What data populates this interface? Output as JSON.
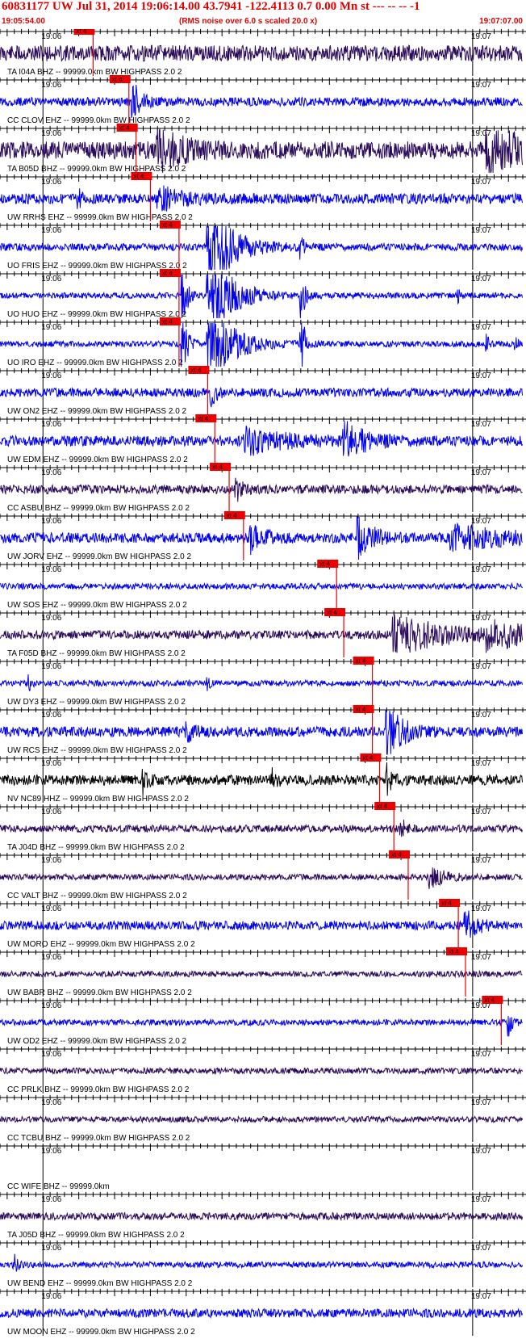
{
  "header": {
    "title": "60831177 UW Jul 31, 2014 19:06:14.00   43.7941 -122.4113  0.7 0.00 Mn st --- -- --  -1",
    "start_time": "19:05:54.00",
    "noise_note": "(RMS noise over 6.0 s scaled 20.0 x)",
    "end_time": "19:07:07.00"
  },
  "chart_data": {
    "type": "line",
    "title": "60831177 UW Jul 31, 2014 19:06:14.00   43.7941 -122.4113  0.7 0.00 Mn st --- -- --  -1",
    "x_start": "19:05:54.00",
    "x_end": "19:07:07.00",
    "tick_labels": [
      "19:06",
      "19:07"
    ],
    "pick_label": "xt 4",
    "colors": {
      "blue": "#0000ee",
      "dark": "#2a0a5a",
      "black": "#000000",
      "pick": "#ee0000",
      "title": "#e00000"
    },
    "traces": [
      {
        "label": "TA I04A BHZ -- 99999.0km BW  HIGHPASS  2.0  2",
        "color": "dark",
        "pick_s": 13.0,
        "amp": 0.55,
        "seed": 11,
        "events": []
      },
      {
        "label": "CC CLOV EHZ -- 99999.0km BW  HIGHPASS  2.0  2",
        "color": "blue",
        "pick_s": 18.0,
        "amp": 0.3,
        "seed": 12,
        "events": [
          {
            "t": 18.5,
            "a": 1.6,
            "w": 1.0
          }
        ]
      },
      {
        "label": "TA B05D BHZ -- 99999.0km BW  HIGHPASS  2.0  2",
        "color": "dark",
        "pick_s": 19.0,
        "amp": 0.6,
        "seed": 13,
        "events": [
          {
            "t": 22,
            "a": 1.4,
            "w": 3.0
          },
          {
            "t": 68,
            "a": 1.6,
            "w": 5.0
          }
        ]
      },
      {
        "label": "UW RRHS EHZ -- 99999.0km BW  HIGHPASS  2.0  2",
        "color": "blue",
        "pick_s": 21.0,
        "amp": 0.35,
        "seed": 14,
        "events": [
          {
            "t": 11,
            "a": 0.9,
            "w": 0.3
          },
          {
            "t": 22,
            "a": 0.8,
            "w": 3.0
          }
        ]
      },
      {
        "label": "UO FRIS EHZ -- 99999.0km BW  HIGHPASS  2.0  2",
        "color": "blue",
        "pick_s": 25.0,
        "amp": 0.25,
        "seed": 15,
        "events": [
          {
            "t": 29,
            "a": 3.5,
            "w": 3.0
          },
          {
            "t": 42,
            "a": 0.9,
            "w": 0.4
          }
        ]
      },
      {
        "label": "UO HUO EHZ -- 99999.0km BW  HIGHPASS  2.0  2",
        "color": "blue",
        "pick_s": 25.0,
        "amp": 0.2,
        "seed": 16,
        "events": [
          {
            "t": 25.5,
            "a": 2.5,
            "w": 0.6
          },
          {
            "t": 29,
            "a": 3.5,
            "w": 3.0
          },
          {
            "t": 42,
            "a": 3.0,
            "w": 0.4
          },
          {
            "t": 64,
            "a": 0.6,
            "w": 0.3
          }
        ]
      },
      {
        "label": "UO IRO EHZ -- 99999.0km BW  HIGHPASS  2.0  2",
        "color": "blue",
        "pick_s": 25.0,
        "amp": 0.2,
        "seed": 17,
        "events": [
          {
            "t": 25.5,
            "a": 2.5,
            "w": 0.6
          },
          {
            "t": 29,
            "a": 3.5,
            "w": 3.0
          },
          {
            "t": 42,
            "a": 3.5,
            "w": 0.4
          },
          {
            "t": 68,
            "a": 0.8,
            "w": 0.3
          },
          {
            "t": 72,
            "a": 0.7,
            "w": 0.3
          }
        ]
      },
      {
        "label": "UW ON2 EHZ -- 99999.0km BW  HIGHPASS  2.0  2",
        "color": "blue",
        "pick_s": 29.0,
        "amp": 0.3,
        "seed": 18,
        "events": [
          {
            "t": 29.5,
            "a": 0.8,
            "w": 0.8
          }
        ]
      },
      {
        "label": "UW EDM EHZ -- 99999.0km BW  HIGHPASS  2.0  2",
        "color": "blue",
        "pick_s": 30.0,
        "amp": 0.35,
        "seed": 19,
        "events": [
          {
            "t": 34,
            "a": 0.9,
            "w": 5.0
          },
          {
            "t": 48,
            "a": 1.2,
            "w": 3.0
          }
        ]
      },
      {
        "label": "CC ASBU BHZ -- 99999.0km BW  HIGHPASS  2.0  2",
        "color": "dark",
        "pick_s": 32.0,
        "amp": 0.3,
        "seed": 20,
        "events": [
          {
            "t": 33,
            "a": 0.8,
            "w": 0.8
          }
        ]
      },
      {
        "label": "UW JORV EHZ -- 99999.0km BW  HIGHPASS  2.0  2",
        "color": "blue",
        "pick_s": 34.0,
        "amp": 0.35,
        "seed": 21,
        "events": [
          {
            "t": 35,
            "a": 0.9,
            "w": 2.0
          },
          {
            "t": 50,
            "a": 2.0,
            "w": 1.5
          },
          {
            "t": 63,
            "a": 0.8,
            "w": 7.0
          }
        ]
      },
      {
        "label": "UW SOS EHZ -- 99999.0km BW  HIGHPASS  2.0  2",
        "color": "blue",
        "pick_s": 47.0,
        "amp": 0.2,
        "seed": 22,
        "events": []
      },
      {
        "label": "TA F05D BHZ -- 99999.0km BW  HIGHPASS  2.0  2",
        "color": "dark",
        "pick_s": 48.0,
        "amp": 0.3,
        "seed": 23,
        "events": [
          {
            "t": 55,
            "a": 1.3,
            "w": 7.0
          },
          {
            "t": 68,
            "a": 1.1,
            "w": 4.0
          }
        ]
      },
      {
        "label": "UW DY3 EHZ -- 99999.0km BW  HIGHPASS  2.0  2",
        "color": "blue",
        "pick_s": 52.0,
        "amp": 0.2,
        "seed": 24,
        "events": [
          {
            "t": 4,
            "a": 0.6,
            "w": 0.3
          },
          {
            "t": 29,
            "a": 0.5,
            "w": 0.3
          },
          {
            "t": 74,
            "a": 0.5,
            "w": 0.3
          }
        ]
      },
      {
        "label": "UW RCS EHZ -- 99999.0km BW  HIGHPASS  2.0  2",
        "color": "blue",
        "pick_s": 52.0,
        "amp": 0.35,
        "seed": 25,
        "events": [
          {
            "t": 54,
            "a": 2.0,
            "w": 2.0
          },
          {
            "t": 26,
            "a": 0.6,
            "w": 1.0
          }
        ]
      },
      {
        "label": "NV NC89 HHZ -- 99999.0km BW  HIGHPASS  2.0  2",
        "color": "black",
        "pick_s": 53.0,
        "amp": 0.35,
        "seed": 26,
        "events": [
          {
            "t": 20,
            "a": 0.8,
            "w": 0.5
          },
          {
            "t": 38,
            "a": 0.8,
            "w": 0.6
          },
          {
            "t": 54,
            "a": 0.9,
            "w": 0.6
          }
        ]
      },
      {
        "label": "TA J04D BHZ -- 99999.0km BW  HIGHPASS  2.0  2",
        "color": "dark",
        "pick_s": 55.0,
        "amp": 0.25,
        "seed": 27,
        "events": [
          {
            "t": 56,
            "a": 0.6,
            "w": 0.8
          }
        ]
      },
      {
        "label": "CC VALT BHZ -- 99999.0km BW  HIGHPASS  2.0  2",
        "color": "dark",
        "pick_s": 57.0,
        "amp": 0.2,
        "seed": 28,
        "events": [
          {
            "t": 60,
            "a": 0.7,
            "w": 2.0
          }
        ]
      },
      {
        "label": "UW MORO EHZ -- 99999.0km BW  HIGHPASS  2.0  2",
        "color": "blue",
        "pick_s": 64.0,
        "amp": 0.3,
        "seed": 29,
        "events": [
          {
            "t": 65,
            "a": 1.0,
            "w": 1.5
          },
          {
            "t": 75,
            "a": 1.1,
            "w": 5.0
          }
        ]
      },
      {
        "label": "UW BABR BHZ -- 99999.0km BW  HIGHPASS  2.0  2",
        "color": "dark",
        "pick_s": 65.0,
        "amp": 0.2,
        "seed": 30,
        "events": []
      },
      {
        "label": "UW OD2 EHZ -- 99999.0km BW  HIGHPASS  2.0  2",
        "color": "blue",
        "pick_s": 70.0,
        "amp": 0.2,
        "seed": 31,
        "events": [
          {
            "t": 71,
            "a": 1.0,
            "w": 0.5
          }
        ]
      },
      {
        "label": "CC PRLK BHZ -- 99999.0km BW  HIGHPASS  2.0  2",
        "color": "dark",
        "pick_s": null,
        "amp": 0.2,
        "seed": 32,
        "events": []
      },
      {
        "label": "CC TCBU BHZ -- 99999.0km BW  HIGHPASS  2.0  2",
        "color": "dark",
        "pick_s": null,
        "amp": 0.2,
        "seed": 33,
        "events": []
      },
      {
        "label": "CC WIFE BHZ -- 99999.0km",
        "color": "dark",
        "pick_s": null,
        "amp": 0.0,
        "seed": 34,
        "events": []
      },
      {
        "label": "TA J05D BHZ -- 99999.0km BW  HIGHPASS  2.0  2",
        "color": "dark",
        "pick_s": null,
        "amp": 0.25,
        "seed": 35,
        "events": []
      },
      {
        "label": "UW BEND EHZ -- 99999.0km BW  HIGHPASS  2.0  2",
        "color": "blue",
        "pick_s": null,
        "amp": 0.2,
        "seed": 36,
        "events": [
          {
            "t": 2,
            "a": 0.7,
            "w": 0.6
          }
        ]
      },
      {
        "label": "UW MOON EHZ -- 99999.0km BW  HIGHPASS  2.0  2",
        "color": "blue",
        "pick_s": null,
        "amp": 0.3,
        "seed": 37,
        "events": []
      }
    ]
  }
}
